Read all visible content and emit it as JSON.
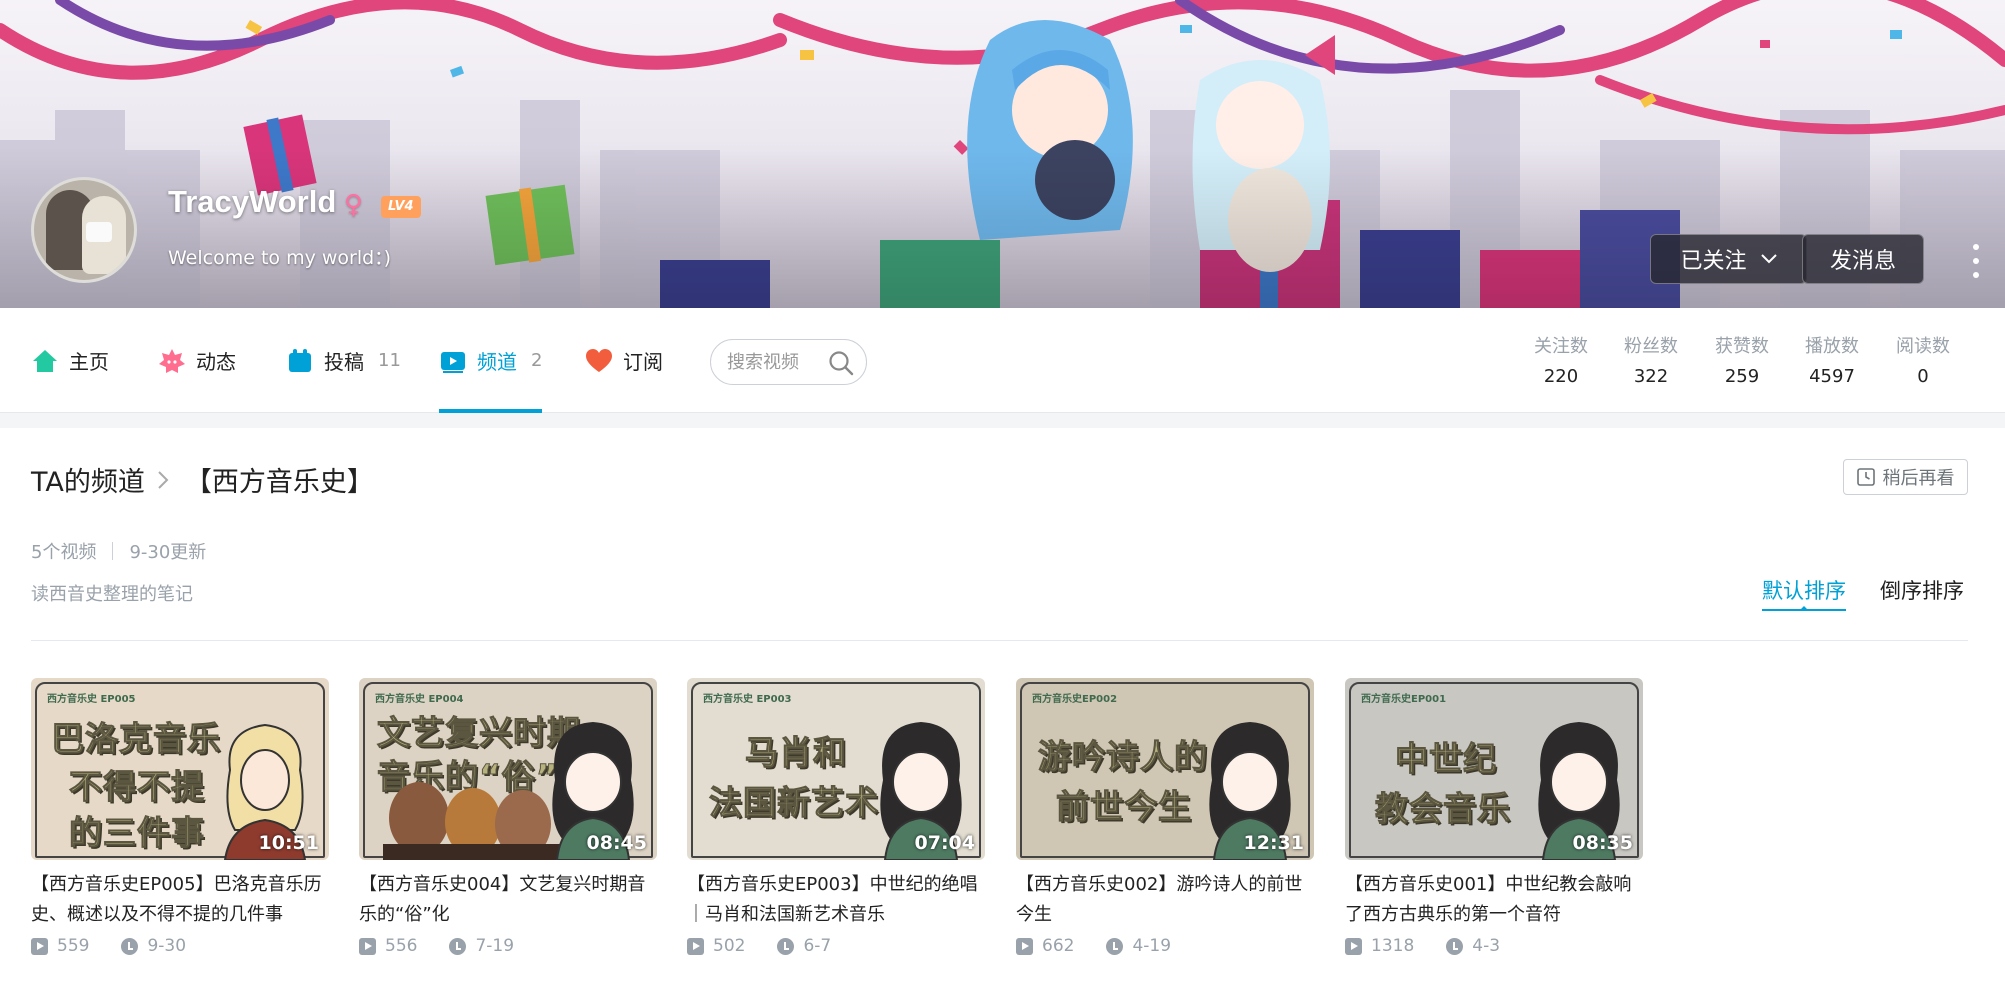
{
  "user": {
    "name": "TracyWorld",
    "gender_symbol": "♀",
    "level": "LV4",
    "signature": "Welcome to my world：)"
  },
  "actions": {
    "follow_label": "已关注",
    "message_label": "发消息"
  },
  "nav": {
    "items": [
      {
        "label": "主页",
        "count": "",
        "icon": "home-icon"
      },
      {
        "label": "动态",
        "count": "",
        "icon": "dynamic-icon"
      },
      {
        "label": "投稿",
        "count": "11",
        "icon": "upload-icon"
      },
      {
        "label": "频道",
        "count": "2",
        "icon": "channel-icon"
      },
      {
        "label": "订阅",
        "count": "",
        "icon": "heart-icon"
      }
    ],
    "active_index": 3,
    "search_placeholder": "搜索视频"
  },
  "stats": [
    {
      "label": "关注数",
      "value": "220"
    },
    {
      "label": "粉丝数",
      "value": "322"
    },
    {
      "label": "获赞数",
      "value": "259"
    },
    {
      "label": "播放数",
      "value": "4597"
    },
    {
      "label": "阅读数",
      "value": "0"
    }
  ],
  "channel": {
    "root_label": "TA的频道",
    "name": "【西方音乐史】",
    "watch_later_label": "稍后再看",
    "video_count": "5个视频",
    "updated": "9-30更新",
    "description": "读西音史整理的笔记",
    "sort_default": "默认排序",
    "sort_reverse": "倒序排序"
  },
  "videos": [
    {
      "tag": "西方音乐史 EP005",
      "thumb_lines": [
        "巴洛克音乐",
        "不得不提",
        "的三件事"
      ],
      "duration": "10:51",
      "title": "【西方音乐史EP005】巴洛克音乐历史、概述以及不得不提的几件事",
      "plays": "559",
      "date": "9-30"
    },
    {
      "tag": "西方音乐史 EP004",
      "thumb_lines": [
        "文艺复兴时期",
        "音乐的“俗”化",
        ""
      ],
      "duration": "08:45",
      "title": "【西方音乐史004】文艺复兴时期音乐的“俗”化",
      "plays": "556",
      "date": "7-19"
    },
    {
      "tag": "西方音乐史 EP003",
      "thumb_lines": [
        "马肖和",
        "法国新艺术",
        ""
      ],
      "duration": "07:04",
      "title": "【西方音乐史EP003】中世纪的绝唱｜马肖和法国新艺术音乐",
      "plays": "502",
      "date": "6-7"
    },
    {
      "tag": "西方音乐史EP002",
      "thumb_lines": [
        "游吟诗人的",
        "前世今生",
        ""
      ],
      "duration": "12:31",
      "title": "【西方音乐史002】游吟诗人的前世今生",
      "plays": "662",
      "date": "4-19"
    },
    {
      "tag": "西方音乐史EP001",
      "thumb_lines": [
        "中世纪",
        "教会音乐",
        ""
      ],
      "duration": "08:35",
      "title": "【西方音乐史001】中世纪教会敲响了西方古典乐的第一个音符",
      "plays": "1318",
      "date": "4-3"
    }
  ],
  "colors": {
    "accent": "#00a1d6",
    "level_badge": "#ffa15c",
    "gender": "#ff6fa0",
    "muted_text": "#99a2aa"
  }
}
